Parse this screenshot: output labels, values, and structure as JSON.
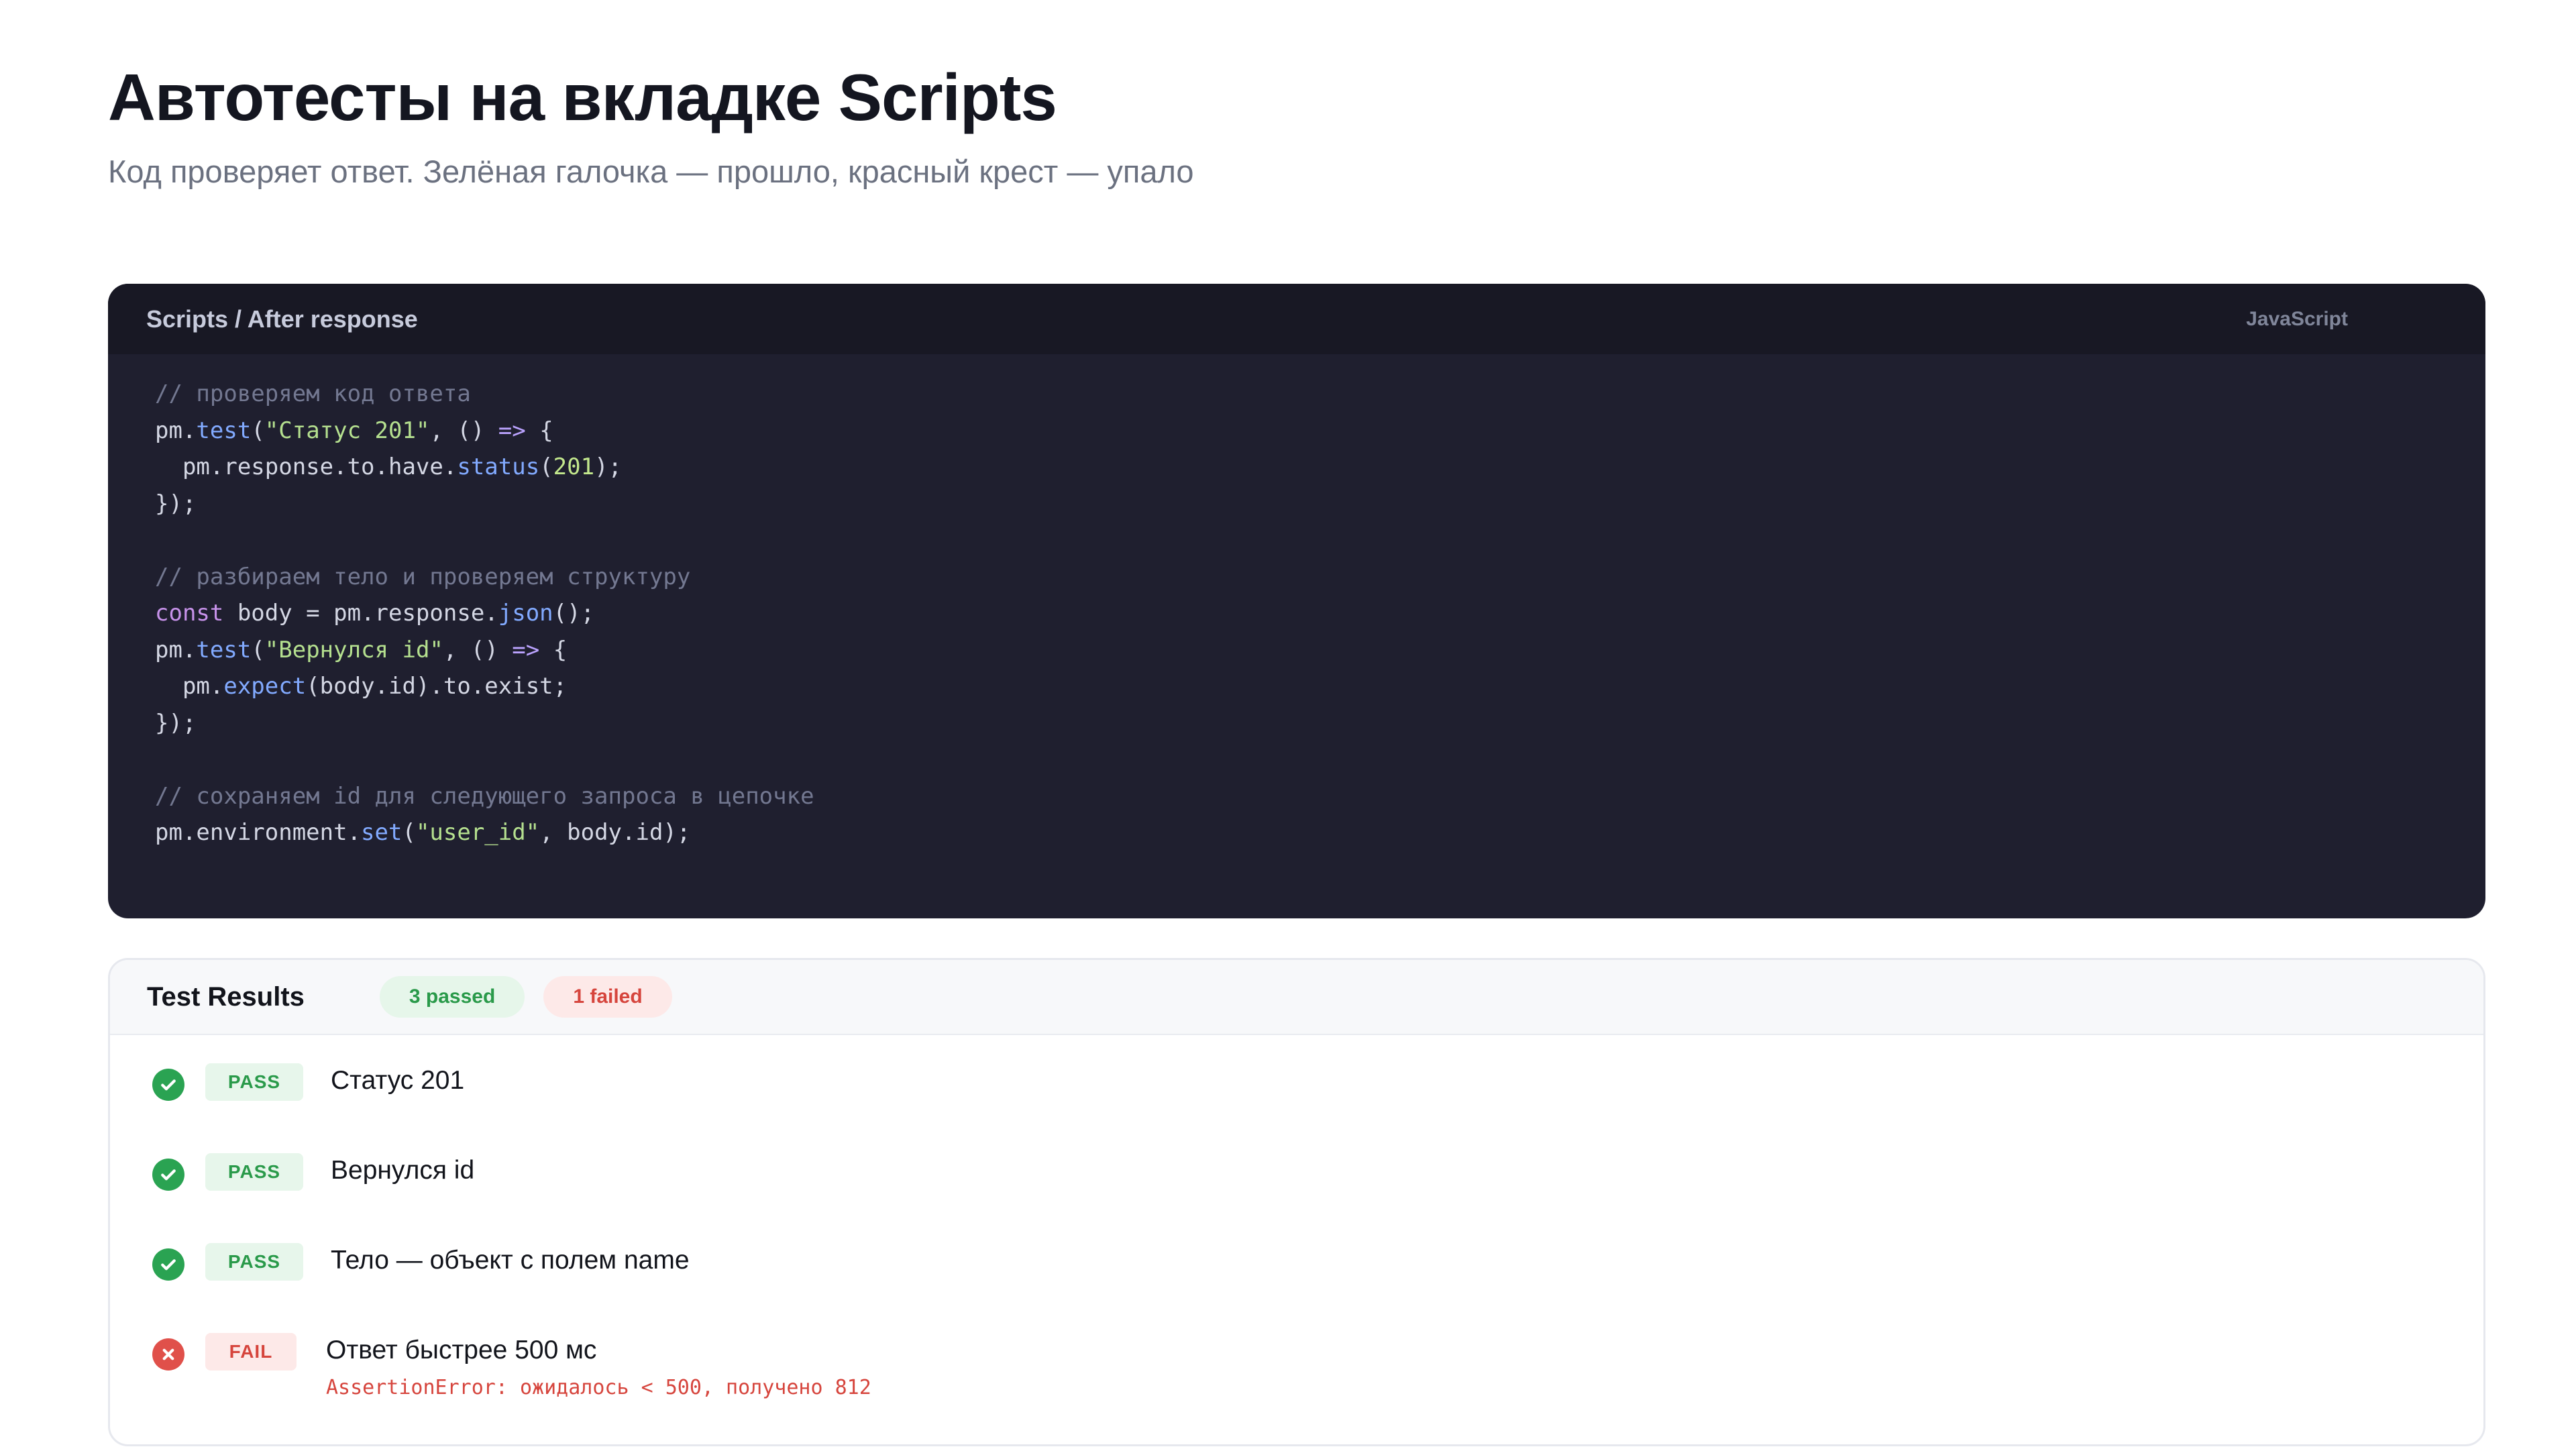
{
  "header": {
    "title": "Автотесты на вкладке Scripts",
    "subtitle": "Код проверяет ответ. Зелёная галочка — прошло, красный крест — упало"
  },
  "code_panel": {
    "path": "Scripts / After response",
    "language": "JavaScript",
    "lines": [
      [
        {
          "t": "// проверяем код ответа",
          "c": "comment"
        }
      ],
      [
        {
          "t": "pm.",
          "c": "plain"
        },
        {
          "t": "test",
          "c": "fn"
        },
        {
          "t": "(",
          "c": "plain"
        },
        {
          "t": "\"Статус 201\"",
          "c": "str"
        },
        {
          "t": ", () ",
          "c": "plain"
        },
        {
          "t": "=>",
          "c": "op"
        },
        {
          "t": " {",
          "c": "plain"
        }
      ],
      [
        {
          "t": "  pm.response.to.have.",
          "c": "plain"
        },
        {
          "t": "status",
          "c": "fn"
        },
        {
          "t": "(",
          "c": "plain"
        },
        {
          "t": "201",
          "c": "num"
        },
        {
          "t": ");",
          "c": "plain"
        }
      ],
      [
        {
          "t": "});",
          "c": "plain"
        }
      ],
      [],
      [
        {
          "t": "// разбираем тело и проверяем структуру",
          "c": "comment"
        }
      ],
      [
        {
          "t": "const",
          "c": "kw"
        },
        {
          "t": " body = pm.response.",
          "c": "plain"
        },
        {
          "t": "json",
          "c": "fn"
        },
        {
          "t": "();",
          "c": "plain"
        }
      ],
      [
        {
          "t": "pm.",
          "c": "plain"
        },
        {
          "t": "test",
          "c": "fn"
        },
        {
          "t": "(",
          "c": "plain"
        },
        {
          "t": "\"Вернулся id\"",
          "c": "str"
        },
        {
          "t": ", () ",
          "c": "plain"
        },
        {
          "t": "=>",
          "c": "op"
        },
        {
          "t": " {",
          "c": "plain"
        }
      ],
      [
        {
          "t": "  pm.",
          "c": "plain"
        },
        {
          "t": "expect",
          "c": "fn"
        },
        {
          "t": "(body.id).to.exist;",
          "c": "plain"
        }
      ],
      [
        {
          "t": "});",
          "c": "plain"
        }
      ],
      [],
      [
        {
          "t": "// сохраняем id для следующего запроса в цепочке",
          "c": "comment"
        }
      ],
      [
        {
          "t": "pm.environment.",
          "c": "plain"
        },
        {
          "t": "set",
          "c": "fn"
        },
        {
          "t": "(",
          "c": "plain"
        },
        {
          "t": "\"user_id\"",
          "c": "str"
        },
        {
          "t": ", body.id);",
          "c": "plain"
        }
      ]
    ]
  },
  "results": {
    "title": "Test Results",
    "passed_label": "3 passed",
    "failed_label": "1 failed",
    "items": [
      {
        "status": "pass",
        "badge": "PASS",
        "name": "Статус 201",
        "icon": "check-circle-icon"
      },
      {
        "status": "pass",
        "badge": "PASS",
        "name": "Вернулся id",
        "icon": "check-circle-icon"
      },
      {
        "status": "pass",
        "badge": "PASS",
        "name": "Тело — объект с полем name",
        "icon": "check-circle-icon"
      },
      {
        "status": "fail",
        "badge": "FAIL",
        "name": "Ответ быстрее 500 мс",
        "error": "AssertionError: ожидалось < 500, получено 812",
        "icon": "x-circle-icon"
      }
    ]
  },
  "colors": {
    "pass": "#2aa352",
    "fail": "#e0504a",
    "code_bg": "#1f1f2f"
  }
}
